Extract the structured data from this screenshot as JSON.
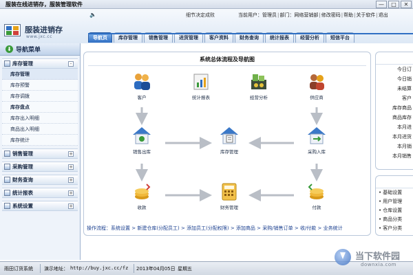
{
  "window": {
    "title": "服装在线进销存，服装管理软件",
    "min_glyph": "—",
    "max_glyph": "□",
    "close_glyph": "✕"
  },
  "header": {
    "logo_name": "服装进销存",
    "logo_url": "www.jxc.cc",
    "notice": "细节决定成败",
    "user_label": "当前用户：",
    "user_name": "管理员",
    "dept_label": "部门：",
    "dept_name": "网络营销部",
    "links": [
      "修改密码",
      "帮助",
      "关于软件",
      "退出"
    ]
  },
  "tabs": [
    "导航页",
    "库存管理",
    "销售管理",
    "进货管理",
    "客户资料",
    "财务查询",
    "统计报表",
    "经营分析",
    "短信平台"
  ],
  "sidebar": {
    "title": "导航菜单",
    "groups": [
      {
        "label": "库存管理",
        "items": [
          "库存管理",
          "库存预警",
          "库存调拨",
          "库存盘点",
          "库存出入明细",
          "商品出入明细",
          "库存统计"
        ]
      },
      {
        "label": "销售管理"
      },
      {
        "label": "采购管理"
      },
      {
        "label": "财务查询"
      },
      {
        "label": "统计报表"
      },
      {
        "label": "系统设置"
      }
    ]
  },
  "main": {
    "title": "系统总体流程及导航图",
    "nodes": {
      "customer": "客户",
      "report": "统计报表",
      "analysis": "经营分析",
      "supplier": "供应商",
      "sales_out": "销售出库",
      "inventory": "库存管理",
      "purchase_in": "采购入库",
      "receive": "收款",
      "finance": "财务管理",
      "payment": "付款"
    },
    "flow_label": "操作流程：",
    "flow_steps": [
      "系统设置",
      "新建仓库(分配员工)",
      "添加员工(分配权限)",
      "添加商品",
      "采购/销售订单",
      "收/付款",
      "业务统计"
    ]
  },
  "right_panel": {
    "stats": [
      "今日订",
      "今日销",
      "未结算",
      "客户",
      "库存商品",
      "商品库存",
      "本月进",
      "本月进货",
      "本月销",
      "本月销售"
    ],
    "list": [
      "基础设置",
      "用户管理",
      "仓库设置",
      "商品分类",
      "客户分类"
    ]
  },
  "status": {
    "company": "雨田订货系统",
    "demo_label": "演示地址：",
    "demo_url": "http://buy.jxc.cc/fz",
    "date": "2013年04月05日",
    "weekday": "星期五"
  },
  "watermark": {
    "text": "当下软件园",
    "sub": "downxia.com"
  },
  "colors": {
    "accent": "#2f6fc3",
    "link": "#1a3f8f",
    "arrow": "#b9bec6"
  }
}
